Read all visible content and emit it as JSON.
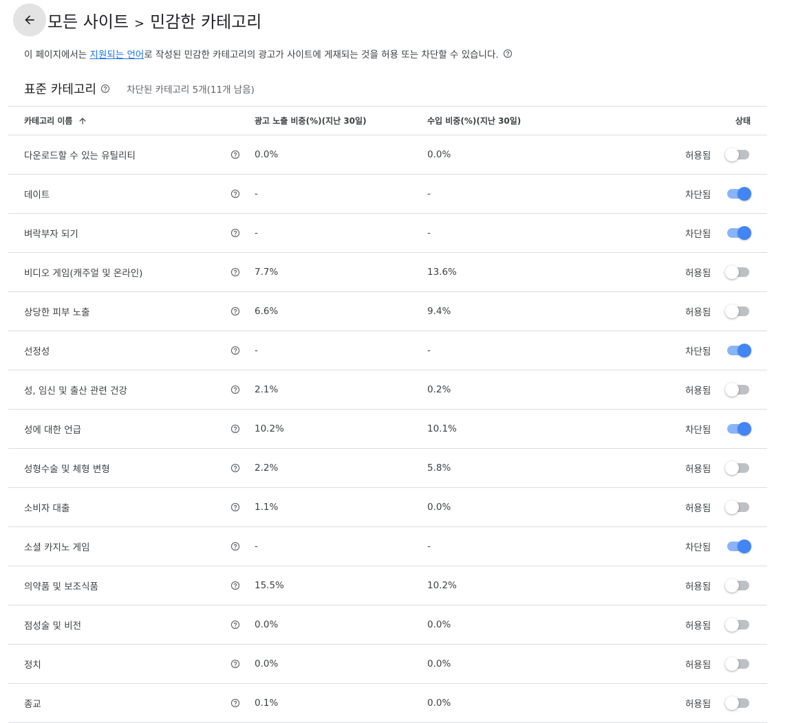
{
  "header": {
    "title_parent": "모든 사이트",
    "title_separator": ">",
    "title_current": "민감한 카테고리"
  },
  "description": {
    "prefix": "이 페이지에서는 ",
    "link": "지원되는 언어",
    "suffix": "로 작성된 민감한 카테고리의 광고가 사이트에 게재되는 것을 허용 또는 차단할 수 있습니다."
  },
  "section": {
    "title": "표준 카테고리",
    "summary": "차단된 카테고리 5개(11개 남음)"
  },
  "table": {
    "headers": {
      "name": "카테고리 이름",
      "impressions": "광고 노출 비중(%)(지난 30일)",
      "revenue": "수입 비중(%)(지난 30일)",
      "status": "상태"
    },
    "rows": [
      {
        "name": "다운로드할 수 있는 유틸리티",
        "impressions": "0.0%",
        "revenue": "0.0%",
        "status": "허용됨",
        "blocked": false
      },
      {
        "name": "데이트",
        "impressions": "-",
        "revenue": "-",
        "status": "차단됨",
        "blocked": true
      },
      {
        "name": "벼락부자 되기",
        "impressions": "-",
        "revenue": "-",
        "status": "차단됨",
        "blocked": true
      },
      {
        "name": "비디오 게임(캐주얼 및 온라인)",
        "impressions": "7.7%",
        "revenue": "13.6%",
        "status": "허용됨",
        "blocked": false
      },
      {
        "name": "상당한 피부 노출",
        "impressions": "6.6%",
        "revenue": "9.4%",
        "status": "허용됨",
        "blocked": false
      },
      {
        "name": "선정성",
        "impressions": "-",
        "revenue": "-",
        "status": "차단됨",
        "blocked": true
      },
      {
        "name": "성, 임신 및 출산 관련 건강",
        "impressions": "2.1%",
        "revenue": "0.2%",
        "status": "허용됨",
        "blocked": false
      },
      {
        "name": "성에 대한 언급",
        "impressions": "10.2%",
        "revenue": "10.1%",
        "status": "차단됨",
        "blocked": true
      },
      {
        "name": "성형수술 및 체형 변형",
        "impressions": "2.2%",
        "revenue": "5.8%",
        "status": "허용됨",
        "blocked": false
      },
      {
        "name": "소비자 대출",
        "impressions": "1.1%",
        "revenue": "0.0%",
        "status": "허용됨",
        "blocked": false
      },
      {
        "name": "소셜 카지노 게임",
        "impressions": "-",
        "revenue": "-",
        "status": "차단됨",
        "blocked": true
      },
      {
        "name": "의약품 및 보조식품",
        "impressions": "15.5%",
        "revenue": "10.2%",
        "status": "허용됨",
        "blocked": false
      },
      {
        "name": "점성술 및 비전",
        "impressions": "0.0%",
        "revenue": "0.0%",
        "status": "허용됨",
        "blocked": false
      },
      {
        "name": "정치",
        "impressions": "0.0%",
        "revenue": "0.0%",
        "status": "허용됨",
        "blocked": false
      },
      {
        "name": "종교",
        "impressions": "0.1%",
        "revenue": "0.0%",
        "status": "허용됨",
        "blocked": false
      }
    ]
  },
  "colors": {
    "link": "#1a73e8",
    "toggle_on": "#4285f4",
    "toggle_off": "#bdc1c6"
  }
}
